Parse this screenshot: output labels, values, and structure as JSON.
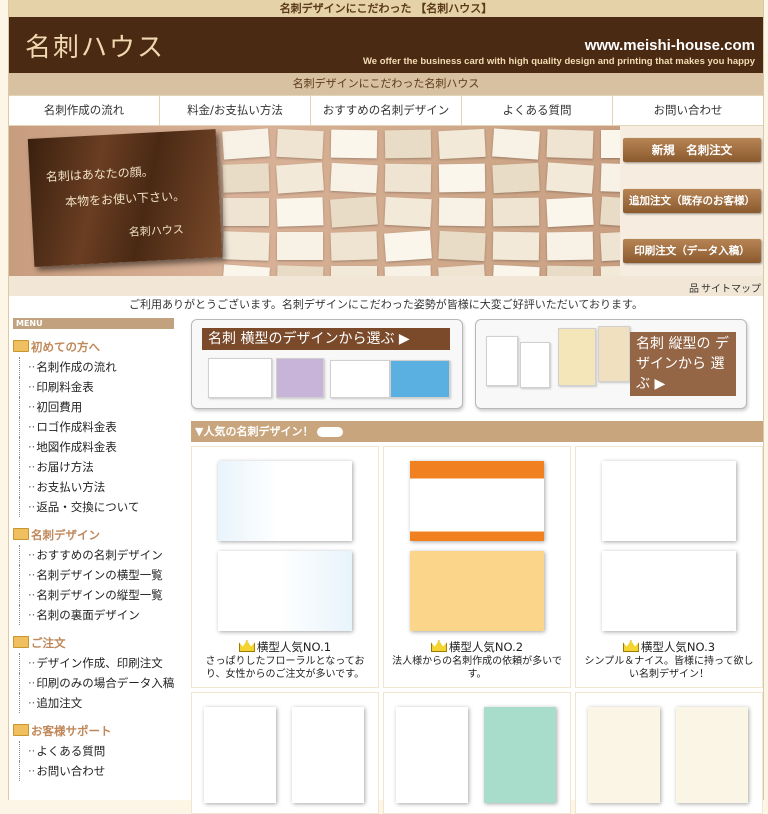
{
  "topbar": {
    "text": "名刺デザインにこだわった 【名刺ハウス】"
  },
  "header": {
    "logo": "名刺ハウス",
    "url": "www.meishi-house.com",
    "tagline": "We offer the business card with high quality design and printing that makes you happy"
  },
  "subbar": {
    "text": "名刺デザインにこだわった名刺ハウス"
  },
  "nav": [
    {
      "label": "名刺作成の流れ"
    },
    {
      "label": "料金/お支払い方法"
    },
    {
      "label": "おすすめの名刺デザイン"
    },
    {
      "label": "よくある質問"
    },
    {
      "label": "お問い合わせ"
    }
  ],
  "hero": {
    "card_line1": "名刺はあなたの顔。",
    "card_line2": "本物をお使い下さい。",
    "card_brand": "名刺ハウス",
    "btn_new": "新規　名刺注文",
    "btn_add": "追加注文（既存のお客様）",
    "btn_print": "印刷注文（データ入稿）"
  },
  "sitemap": "サイトマップ",
  "thanks": "ご利用ありがとうございます。名刺デザインにこだわった姿勢が皆様に大変ご好評いただいております。",
  "sidebar": {
    "menu": "MENU",
    "sections": [
      {
        "title": "初めての方へ",
        "items": [
          "名刺作成の流れ",
          "印刷料金表",
          "初回費用",
          "ロゴ作成料金表",
          "地図作成料金表",
          "お届け方法",
          "お支払い方法",
          "返品・交換について"
        ]
      },
      {
        "title": "名刺デザイン",
        "items": [
          "おすすめの名刺デザイン",
          "名刺デザインの横型一覧",
          "名刺デザインの縦型一覧",
          "名刺の裏面デザイン"
        ]
      },
      {
        "title": "ご注文",
        "items": [
          "デザイン作成、印刷注文",
          "印刷のみの場合データ入稿",
          "追加注文"
        ]
      },
      {
        "title": "お客様サポート",
        "items": [
          "よくある質問",
          "お問い合わせ"
        ]
      }
    ]
  },
  "promo": {
    "horizontal": "名刺  横型のデザインから選ぶ ▶",
    "vertical": "名刺  縦型の デザインから 選ぶ ▶"
  },
  "popular": {
    "header": "▼人気の名刺デザイン！",
    "items": [
      {
        "label": "横型人気NO.1",
        "desc": "さっぱりしたフローラルとなっており、女性からのご注文が多いです。"
      },
      {
        "label": "横型人気NO.2",
        "desc": "法人様からの名刺作成の依頼が多いです。"
      },
      {
        "label": "横型人気NO.3",
        "desc": "シンプル＆ナイス。皆様に持って欲しい名刺デザイン！"
      }
    ]
  },
  "colors": {
    "header_bg": "#4a2a12",
    "accent": "#c8a57c",
    "button": "#8a5a2e"
  }
}
